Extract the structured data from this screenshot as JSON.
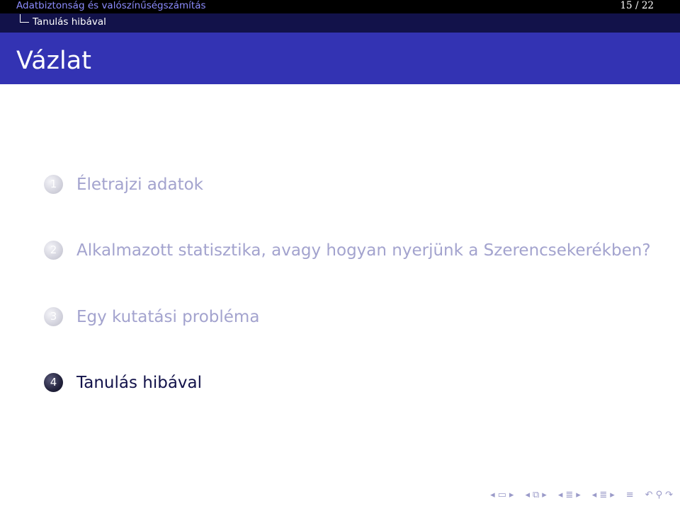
{
  "header": {
    "deck_title": "Adatbiztonság és valószínűségszámítás",
    "page_current": "15",
    "page_total": "22",
    "page_separator": "/",
    "section_crumb": "Tanulás hibával"
  },
  "frame": {
    "title": "Vázlat"
  },
  "toc": [
    {
      "number": "1",
      "label": "Életrajzi adatok",
      "active": false
    },
    {
      "number": "2",
      "label": "Alkalmazott statisztika, avagy hogyan nyerjünk a Szerencsekerékben?",
      "active": false
    },
    {
      "number": "3",
      "label": "Egy kutatási probléma",
      "active": false
    },
    {
      "number": "4",
      "label": "Tanulás hibával",
      "active": true
    }
  ],
  "colors": {
    "headline_top": "#000000",
    "headline_bottom": "#12124a",
    "title_bar": "#3333b3",
    "deck_title": "#8c8cff",
    "inactive_text": "#a3a3ce",
    "active_text": "#12124a"
  },
  "nav": {
    "icons": [
      "arrow-left-icon",
      "frame-icon",
      "arrow-right-icon",
      "arrow-left-icon",
      "subsection-icon",
      "arrow-right-icon",
      "arrow-left-icon",
      "section-icon",
      "arrow-right-icon",
      "arrow-left-icon",
      "subsection-icon",
      "arrow-right-icon",
      "align-icon",
      "search-back-icon",
      "search-icon",
      "search-forward-icon"
    ]
  }
}
